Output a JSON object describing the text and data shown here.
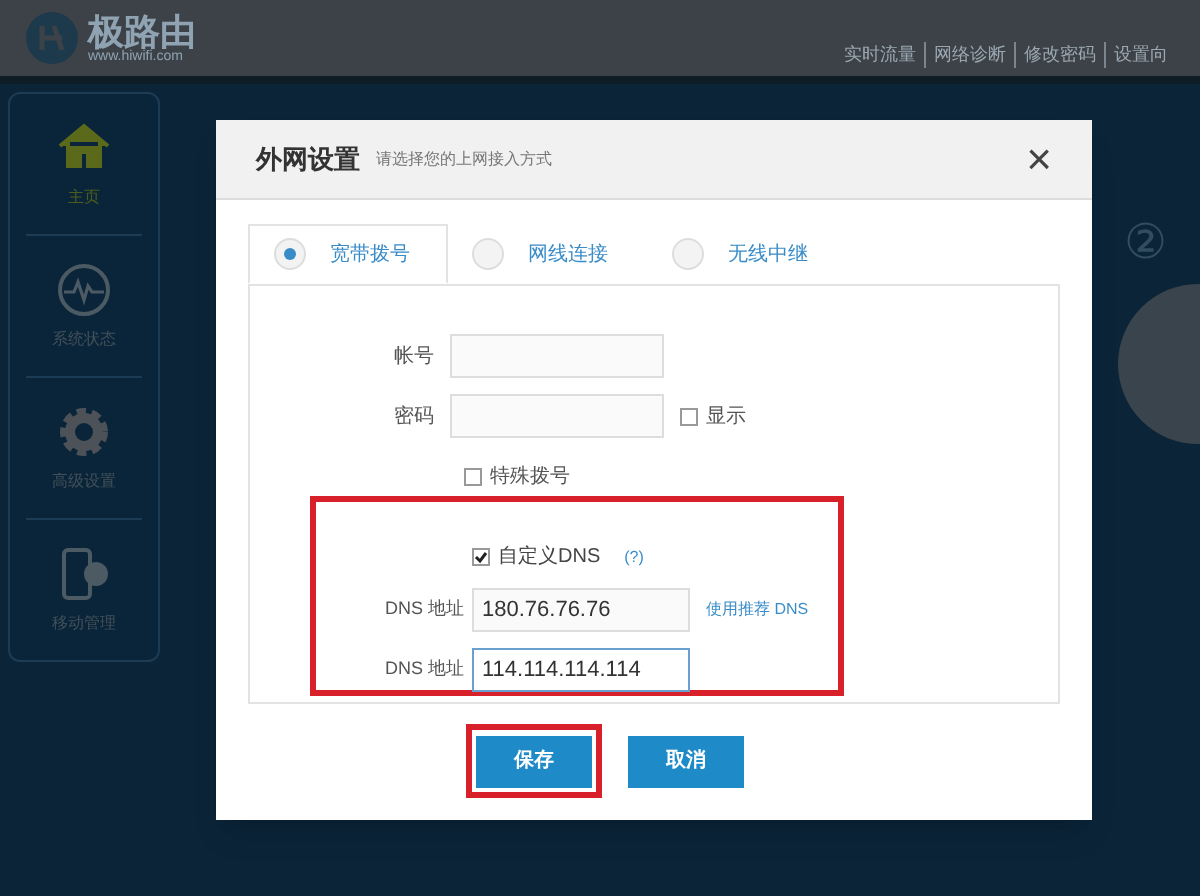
{
  "header": {
    "logo": {
      "name": "极路由",
      "url": "www.hiwifi.com"
    },
    "nav": [
      "实时流量",
      "网络诊断",
      "修改密码",
      "设置向"
    ]
  },
  "sidebar": {
    "items": [
      {
        "label": "主页",
        "kind": "home",
        "selected": true
      },
      {
        "label": "系统状态",
        "kind": "status",
        "selected": false
      },
      {
        "label": "高级设置",
        "kind": "settings",
        "selected": false
      },
      {
        "label": "移动管理",
        "kind": "mobile",
        "selected": false
      }
    ]
  },
  "background": {
    "step": "②"
  },
  "dialog": {
    "title": "外网设置",
    "subtitle": "请选择您的上网接入方式",
    "close": "×",
    "tabs": [
      {
        "label": "宽带拨号",
        "selected": true
      },
      {
        "label": "网线连接",
        "selected": false
      },
      {
        "label": "无线中继",
        "selected": false
      }
    ],
    "fields": [
      {
        "label": "帐号"
      },
      {
        "label": "密码",
        "show_password": {
          "label": "显示",
          "checked": false
        }
      }
    ],
    "special_dial": {
      "label": "特殊拨号",
      "checked": false
    },
    "dns_section": {
      "highlighted": true,
      "custom_dns": {
        "label": "自定义DNS",
        "checked": true,
        "help": "(?)"
      },
      "rows": [
        {
          "label": "DNS 地址",
          "value": "180.76.76.76",
          "link": "使用推荐 DNS",
          "focused": false
        },
        {
          "label": "DNS 地址",
          "value": "114.114.114.114",
          "focused": true
        }
      ]
    },
    "buttons": [
      {
        "label": "保存",
        "highlighted": true
      },
      {
        "label": "取消"
      }
    ]
  }
}
